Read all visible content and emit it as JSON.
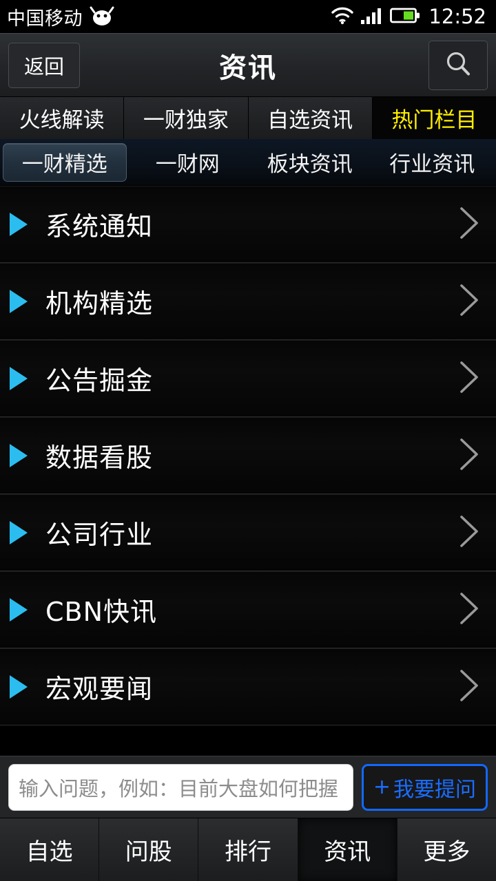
{
  "status_bar": {
    "carrier": "中国移动",
    "robot_icon": "android-robot-icon",
    "wifi_icon": "wifi-icon",
    "signal_icon": "cellular-signal-icon",
    "battery_icon": "battery-icon",
    "battery_color": "#66dd22",
    "clock": "12:52"
  },
  "header": {
    "back_label": "返回",
    "title": "资讯",
    "search_icon": "search-icon"
  },
  "tabs_primary": {
    "items": [
      {
        "label": "火线解读",
        "active": false
      },
      {
        "label": "一财独家",
        "active": false
      },
      {
        "label": "自选资讯",
        "active": false
      },
      {
        "label": "热门栏目",
        "active": true
      }
    ],
    "active_color": "#ffef00"
  },
  "tabs_secondary": {
    "items": [
      {
        "label": "一财精选",
        "active": true
      },
      {
        "label": "一财网",
        "active": false
      },
      {
        "label": "板块资讯",
        "active": false
      },
      {
        "label": "行业资讯",
        "active": false
      }
    ]
  },
  "news_list": {
    "bullet_color": "#2bbdf0",
    "chevron_icon": "chevron-right-icon",
    "items": [
      {
        "label": "系统通知"
      },
      {
        "label": "机构精选"
      },
      {
        "label": "公告掘金"
      },
      {
        "label": "数据看股"
      },
      {
        "label": "公司行业"
      },
      {
        "label": "CBN快讯"
      },
      {
        "label": "宏观要闻"
      }
    ]
  },
  "ask_bar": {
    "input_value": "",
    "input_placeholder": "输入问题，例如：目前大盘如何把握",
    "submit_plus": "+",
    "submit_label": "我要提问",
    "submit_color": "#1a6dff"
  },
  "bottom_nav": {
    "items": [
      {
        "label": "自选",
        "active": false
      },
      {
        "label": "问股",
        "active": false
      },
      {
        "label": "排行",
        "active": false
      },
      {
        "label": "资讯",
        "active": true
      },
      {
        "label": "更多",
        "active": false
      }
    ]
  }
}
